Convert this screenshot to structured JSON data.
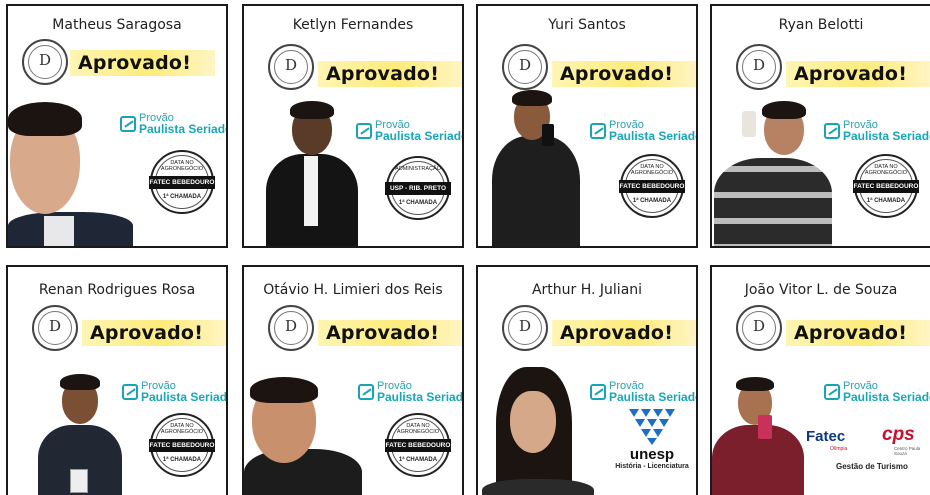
{
  "badge": "Aprovado!",
  "provao": {
    "line1": "Provão",
    "line2": "Paulista Seriado"
  },
  "stamps": {
    "fatec": {
      "top": "DATA NO AGRONEGÓCIO",
      "band": "FATEC BEBEDOURO",
      "bottom": "1ª CHAMADA"
    },
    "usp": {
      "top": "ADMINISTRAÇÃO",
      "band": "USP - RIB. PRETO",
      "bottom": "1ª CHAMADA"
    }
  },
  "unesp": {
    "name": "unesp",
    "sub": "História - Licenciatura"
  },
  "fatec_olimpia": {
    "name": "Fatec",
    "sub": "Olímpia",
    "cps": "cps",
    "cps_sub": "Centro Paula Souza",
    "course": "Gestão de Turismo"
  },
  "colors": {
    "badge_highlight": "#fdeb7a",
    "brand_teal": "#16a7b8",
    "card_border": "#1a1a1a"
  },
  "cards": [
    {
      "name": "Matheus Saragosa"
    },
    {
      "name": "Ketlyn Fernandes"
    },
    {
      "name": "Yuri Santos"
    },
    {
      "name": "Ryan Belotti"
    },
    {
      "name": "Renan Rodrigues Rosa"
    },
    {
      "name": "Otávio H. Limieri dos Reis"
    },
    {
      "name": "Arthur H. Juliani"
    },
    {
      "name": "João Vitor L. de Souza"
    }
  ]
}
